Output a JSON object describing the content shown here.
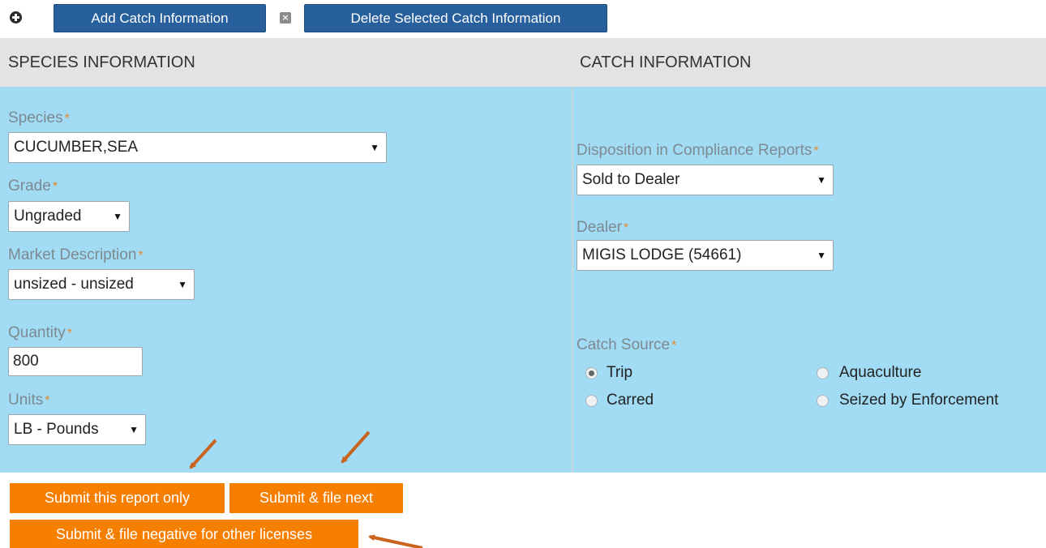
{
  "toolbar": {
    "add_label": "Add Catch Information",
    "delete_label": "Delete Selected Catch Information",
    "add_icon": "plus-circle-icon",
    "delete_icon": "close-box-icon"
  },
  "sections": {
    "species_header": "SPECIES INFORMATION",
    "catch_header": "CATCH INFORMATION"
  },
  "species": {
    "species_label": "Species",
    "species_value": "CUCUMBER,SEA",
    "grade_label": "Grade",
    "grade_value": "Ungraded",
    "market_label": "Market Description",
    "market_value": "unsized - unsized",
    "quantity_label": "Quantity",
    "quantity_value": "800",
    "units_label": "Units",
    "units_value": "LB - Pounds"
  },
  "catch": {
    "disposition_label": "Disposition in Compliance Reports",
    "disposition_value": "Sold to Dealer",
    "dealer_label": "Dealer",
    "dealer_value": "MIGIS LODGE (54661)",
    "source_label": "Catch Source",
    "sources": [
      {
        "label": "Trip",
        "selected": true
      },
      {
        "label": "Aquaculture",
        "selected": false
      },
      {
        "label": "Carred",
        "selected": false
      },
      {
        "label": "Seized by Enforcement",
        "selected": false
      }
    ]
  },
  "required_mark": "*",
  "caret": "▼",
  "actions": {
    "submit_only": "Submit this report only",
    "submit_next": "Submit & file next",
    "submit_negative": "Submit & file negative for other licenses"
  },
  "colors": {
    "toolbar_button": "#27609d",
    "panel_bg": "#a1dbf4",
    "header_bg": "#e3e3e3",
    "action_button": "#f77f00",
    "required": "#e68a2e",
    "arrow": "#c8641e"
  }
}
